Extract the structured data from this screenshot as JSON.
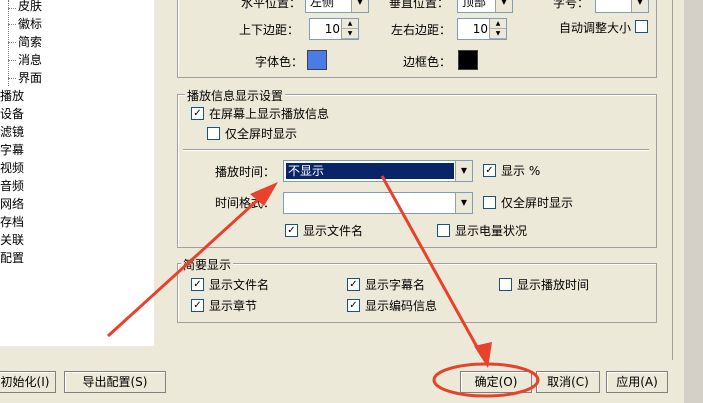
{
  "tree": {
    "items": [
      {
        "label": "皮肤",
        "level": "child"
      },
      {
        "label": "徽标",
        "level": "child"
      },
      {
        "label": "简索",
        "level": "child"
      },
      {
        "label": "消息",
        "level": "child"
      },
      {
        "label": "界面",
        "level": "child"
      },
      {
        "label": "播放",
        "level": "root"
      },
      {
        "label": "设备",
        "level": "root"
      },
      {
        "label": "滤镜",
        "level": "root"
      },
      {
        "label": "字幕",
        "level": "root"
      },
      {
        "label": "视频",
        "level": "root"
      },
      {
        "label": "音频",
        "level": "root"
      },
      {
        "label": "网络",
        "level": "root"
      },
      {
        "label": "存档",
        "level": "root"
      },
      {
        "label": "关联",
        "level": "root"
      },
      {
        "label": "配置",
        "level": "root"
      }
    ]
  },
  "top_group": {
    "h_pos_label": "水平位置：",
    "h_pos_value": "左侧",
    "v_pos_label": "垂直位置：",
    "v_pos_value": "顶部",
    "font_size_label": "字号：",
    "tb_margin_label": "上下边距：",
    "tb_margin_value": "10",
    "lr_margin_label": "左右边距：",
    "lr_margin_value": "10",
    "auto_size_label": "自动调整大小",
    "font_color_label": "字体色：",
    "font_color": "#4a7be8",
    "border_color_label": "边框色：",
    "border_color": "#000000"
  },
  "play_info": {
    "legend": "播放信息显示设置",
    "show_on_screen": "在屏幕上显示播放信息",
    "fullscreen_only": "仅全屏时显示",
    "play_time_label": "播放时间：",
    "play_time_value": "不显示",
    "show_percent": "显示 %",
    "time_format_label": "时间格式：",
    "time_fullscreen_only": "仅全屏时显示",
    "show_filename": "显示文件名",
    "show_battery": "显示电量状况"
  },
  "brief": {
    "legend": "简要显示",
    "show_filename": "显示文件名",
    "show_subtitle": "显示字幕名",
    "show_play_time": "显示播放时间",
    "show_chapter": "显示章节",
    "show_encoding": "显示编码信息"
  },
  "buttons": {
    "init": "初始化(I)",
    "export": "导出配置(S)",
    "ok": "确定(O)",
    "cancel": "取消(C)",
    "apply": "应用(A)"
  },
  "colors": {
    "annotation": "#e8412c",
    "selection": "#0a246a"
  }
}
